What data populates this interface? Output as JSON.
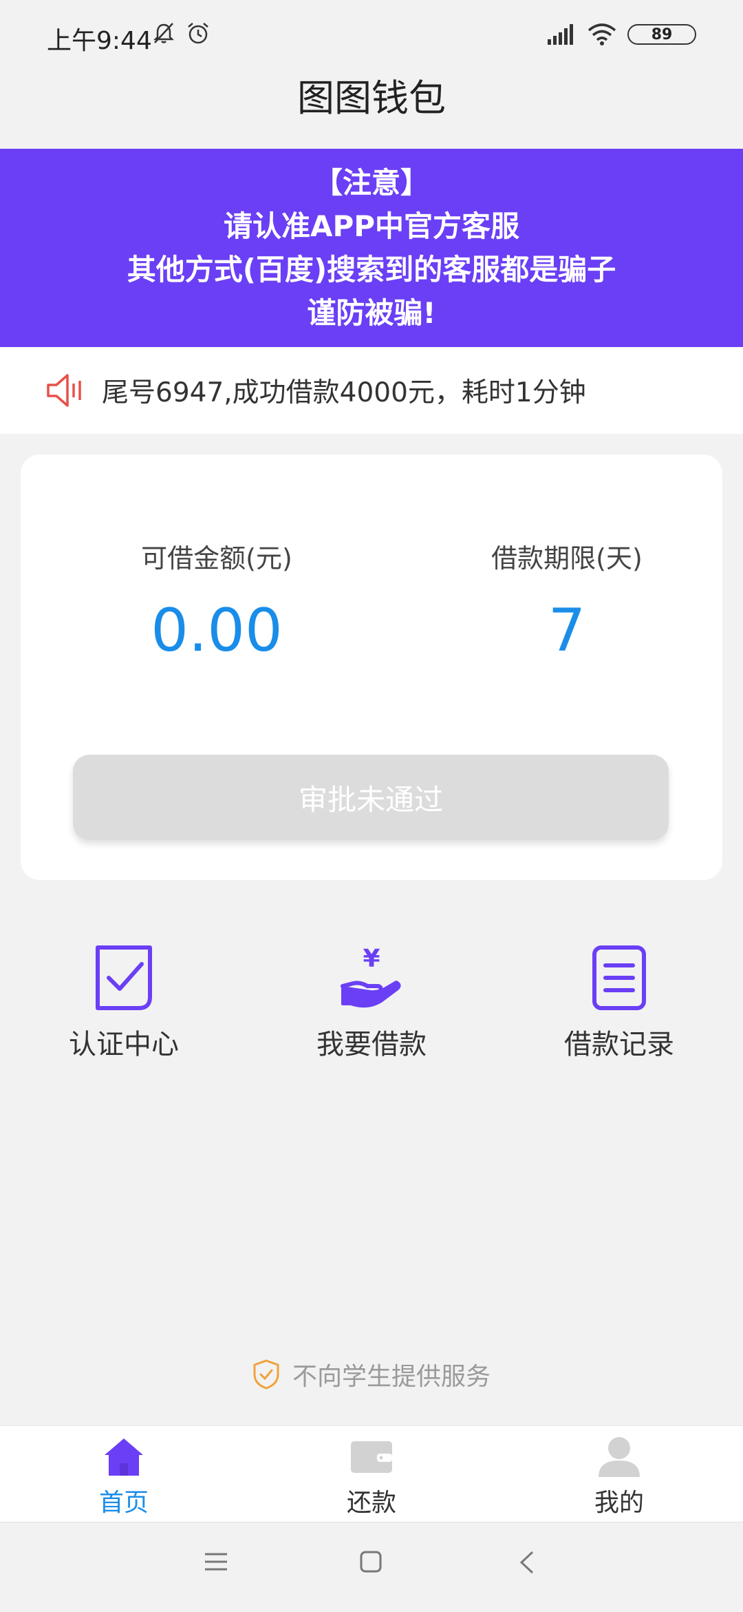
{
  "status_bar": {
    "time": "上午9:44",
    "battery": "89"
  },
  "app": {
    "title": "图图钱包"
  },
  "banner": {
    "lines": [
      "【注意】",
      "请认准APP中官方客服",
      "其他方式(百度)搜索到的客服都是骗子",
      "谨防被骗!"
    ]
  },
  "notice": {
    "text": "尾号6947,成功借款4000元，耗时1分钟",
    "icon": "speaker-icon"
  },
  "loan_card": {
    "amount_label": "可借金额(元)",
    "amount_value": "0.00",
    "term_label": "借款期限(天)",
    "term_value": "7",
    "approve_button": "审批未通过"
  },
  "menu": {
    "items": [
      {
        "label": "认证中心",
        "icon": "checkbox-icon"
      },
      {
        "label": "我要借款",
        "icon": "yen-hand-icon"
      },
      {
        "label": "借款记录",
        "icon": "list-doc-icon"
      }
    ]
  },
  "footer": {
    "note": "不向学生提供服务"
  },
  "tabs": [
    {
      "label": "首页",
      "icon": "home-icon",
      "active": true
    },
    {
      "label": "还款",
      "icon": "wallet-icon"
    },
    {
      "label": "我的",
      "icon": "user-icon"
    }
  ],
  "colors": {
    "brand": "#6a3ff5",
    "accent_blue": "#1a8de9",
    "alert_red": "#e8504a"
  }
}
